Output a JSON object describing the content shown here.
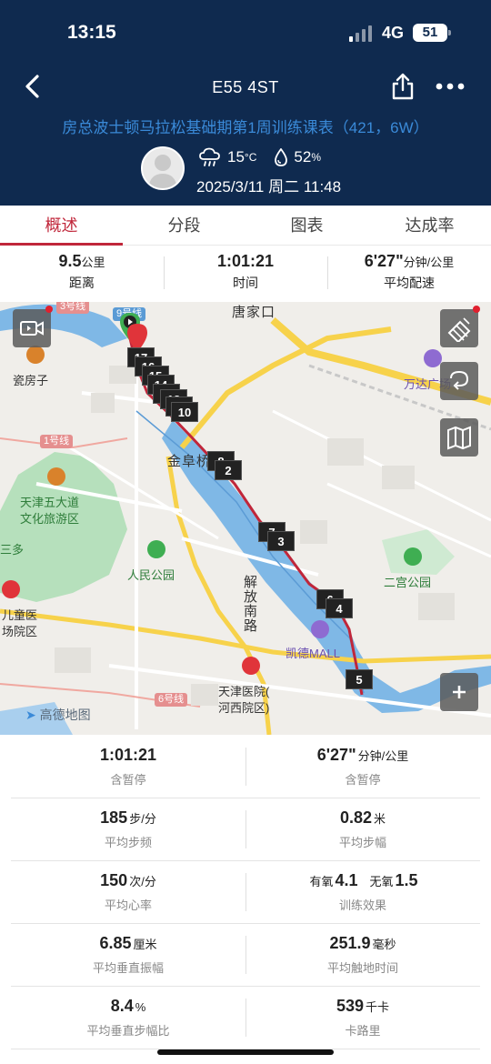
{
  "status": {
    "time": "13:15",
    "network": "4G",
    "battery": "51"
  },
  "nav": {
    "title": "E55 4ST"
  },
  "plan_title": "房总波士顿马拉松基础期第1周训练课表（421，6W）",
  "weather": {
    "temp": "15",
    "temp_unit": "°C",
    "humidity": "52",
    "humidity_unit": "%"
  },
  "datetime": "2025/3/11 周二 11:48",
  "tabs": [
    "概述",
    "分段",
    "图表",
    "达成率"
  ],
  "summary": [
    {
      "value": "9.5",
      "unit": "公里",
      "label": "距离"
    },
    {
      "value": "1:01:21",
      "unit": "",
      "label": "时间"
    },
    {
      "value": "6'27\"",
      "unit": "分钟/公里",
      "label": "平均配速"
    }
  ],
  "map": {
    "labels": {
      "tangjiakou": "唐家口",
      "ciwangzi": "瓷房子",
      "wanda": "万达广场",
      "jinbuqiao": "金阜桥",
      "tianjin_wudadao_1": "天津五大道",
      "tianjin_wudadao_2": "文化旅游区",
      "sanduo": "三多",
      "renmin_park": "人民公园",
      "jiefang_road": "解放南路",
      "erguan_park": "二宫公园",
      "kaide_mall": "凯德MALL",
      "children_hosp_1": "儿童医",
      "children_hosp_2": "场院区",
      "tianjin_hosp_1": "天津医院(",
      "tianjin_hosp_2": "河西院区)",
      "amap": "高德地图"
    },
    "metro": {
      "line1": "1号线",
      "line3": "3号线",
      "line6": "6号线",
      "line9": "9号线"
    },
    "km_markers": [
      "17",
      "16",
      "15",
      "14",
      "13",
      "12",
      "11",
      "10",
      "8",
      "2",
      "7",
      "3",
      "6",
      "4",
      "5"
    ],
    "colors": {
      "route": "#c0263a",
      "river": "#7fb8e6",
      "park": "#7cc98a",
      "road": "#f7d24b"
    }
  },
  "stats": [
    {
      "left": {
        "value": "1:01:21",
        "unit": "",
        "label": "含暂停"
      },
      "right": {
        "value": "6'27\"",
        "unit": "分钟/公里",
        "label": "含暂停"
      }
    },
    {
      "left": {
        "value": "185",
        "unit": "步/分",
        "label": "平均步频"
      },
      "right": {
        "value": "0.82",
        "unit": "米",
        "label": "平均步幅"
      }
    },
    {
      "left": {
        "value": "150",
        "unit": "次/分",
        "label": "平均心率"
      },
      "right": {
        "aerobic_label": "有氧",
        "aerobic": "4.1",
        "anaerobic_label": "无氧",
        "anaerobic": "1.5",
        "label": "训练效果"
      }
    },
    {
      "left": {
        "value": "6.85",
        "unit": "厘米",
        "label": "平均垂直振幅"
      },
      "right": {
        "value": "251.9",
        "unit": "毫秒",
        "label": "平均触地时间"
      }
    },
    {
      "left": {
        "value": "8.4",
        "unit": "%",
        "label": "平均垂直步幅比"
      },
      "right": {
        "value": "539",
        "unit": "千卡",
        "label": "卡路里"
      }
    }
  ]
}
